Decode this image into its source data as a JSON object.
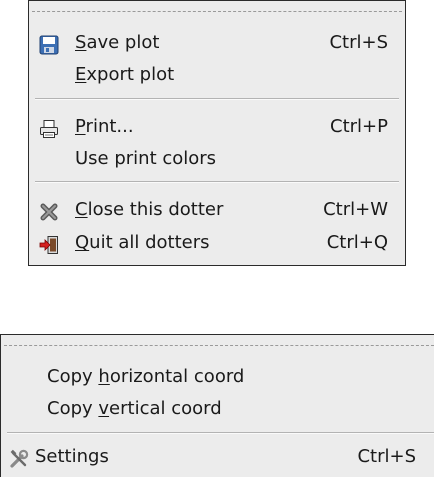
{
  "file_menu": {
    "save_plot": {
      "pre": "",
      "u": "S",
      "post": "ave plot",
      "accel": "Ctrl+S",
      "icon": "save-icon"
    },
    "export_plot": {
      "pre": "",
      "u": "E",
      "post": "xport plot"
    },
    "print": {
      "pre": "",
      "u": "P",
      "post": "rint...",
      "accel": "Ctrl+P",
      "icon": "print-icon"
    },
    "use_print_colors": {
      "label": "Use print colors"
    },
    "close_dotter": {
      "pre": "",
      "u": "C",
      "post": "lose this dotter",
      "accel": "Ctrl+W",
      "icon": "close-icon"
    },
    "quit_dotters": {
      "pre": "",
      "u": "Q",
      "post": "uit all dotters",
      "accel": "Ctrl+Q",
      "icon": "quit-icon"
    }
  },
  "context_menu": {
    "copy_horizontal": {
      "pre": "Copy ",
      "u": "h",
      "post": "orizontal coord"
    },
    "copy_vertical": {
      "pre": "Copy ",
      "u": "v",
      "post": "ertical coord"
    },
    "settings": {
      "label": "Settings",
      "accel": "Ctrl+S",
      "icon": "settings-icon"
    }
  }
}
